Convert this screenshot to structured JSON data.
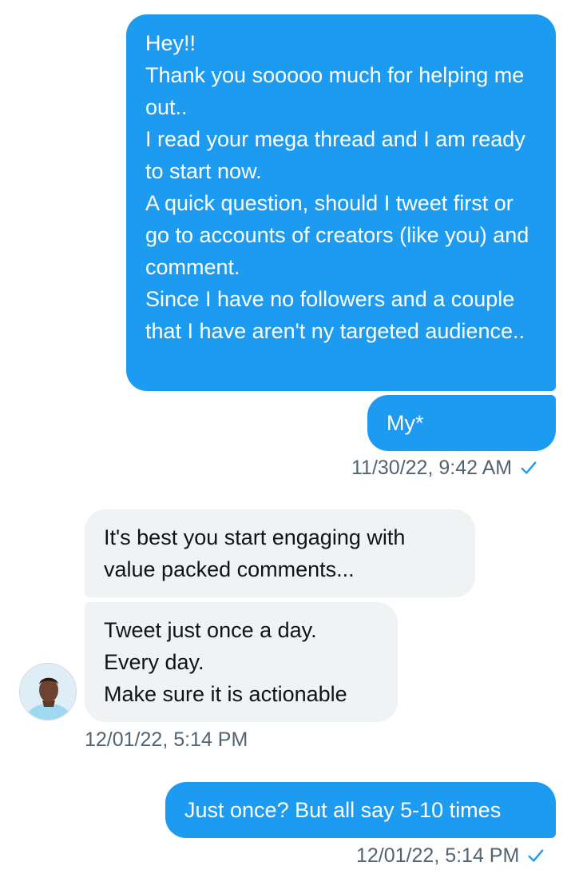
{
  "conversation": {
    "messages": [
      {
        "direction": "sent",
        "text": "Hey!!\nThank you sooooo much for helping me out..\nI read your mega thread and I am ready to start now.\nA quick question, should I tweet first or go to accounts of creators (like you) and comment.\nSince I have no followers and a couple that I have aren't ny targeted audience.."
      },
      {
        "direction": "sent",
        "text": "My*"
      },
      {
        "direction": "received",
        "text": "It's best you start engaging with value packed comments..."
      },
      {
        "direction": "received",
        "text": "Tweet just once a day.\nEvery day.\nMake sure it is actionable"
      },
      {
        "direction": "sent",
        "text": "Just once? But all say 5-10 times"
      }
    ],
    "timestamps": {
      "first_sent": "11/30/22, 9:42 AM",
      "received": "12/01/22, 5:14 PM",
      "second_sent": "12/01/22, 5:14 PM"
    },
    "status_icon": "checkmark-icon",
    "colors": {
      "sent_bubble": "#1d9bf0",
      "received_bubble": "#eff3f4",
      "timestamp_text": "#536471",
      "checkmark": "#1d9bf0"
    }
  }
}
